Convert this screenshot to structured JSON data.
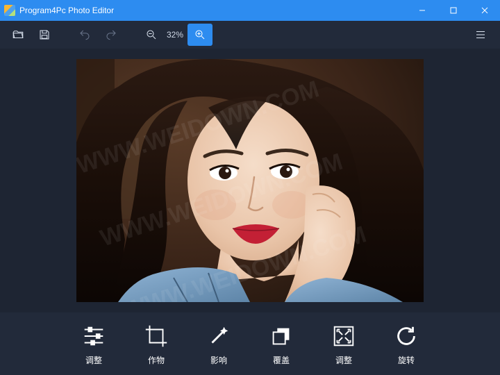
{
  "window": {
    "title": "Program4Pc Photo Editor"
  },
  "toolbar": {
    "zoom_label": "32%"
  },
  "bottom_tools": [
    {
      "label": "调整"
    },
    {
      "label": "作物"
    },
    {
      "label": "影响"
    },
    {
      "label": "覆盖"
    },
    {
      "label": "调整"
    },
    {
      "label": "旋转"
    }
  ]
}
